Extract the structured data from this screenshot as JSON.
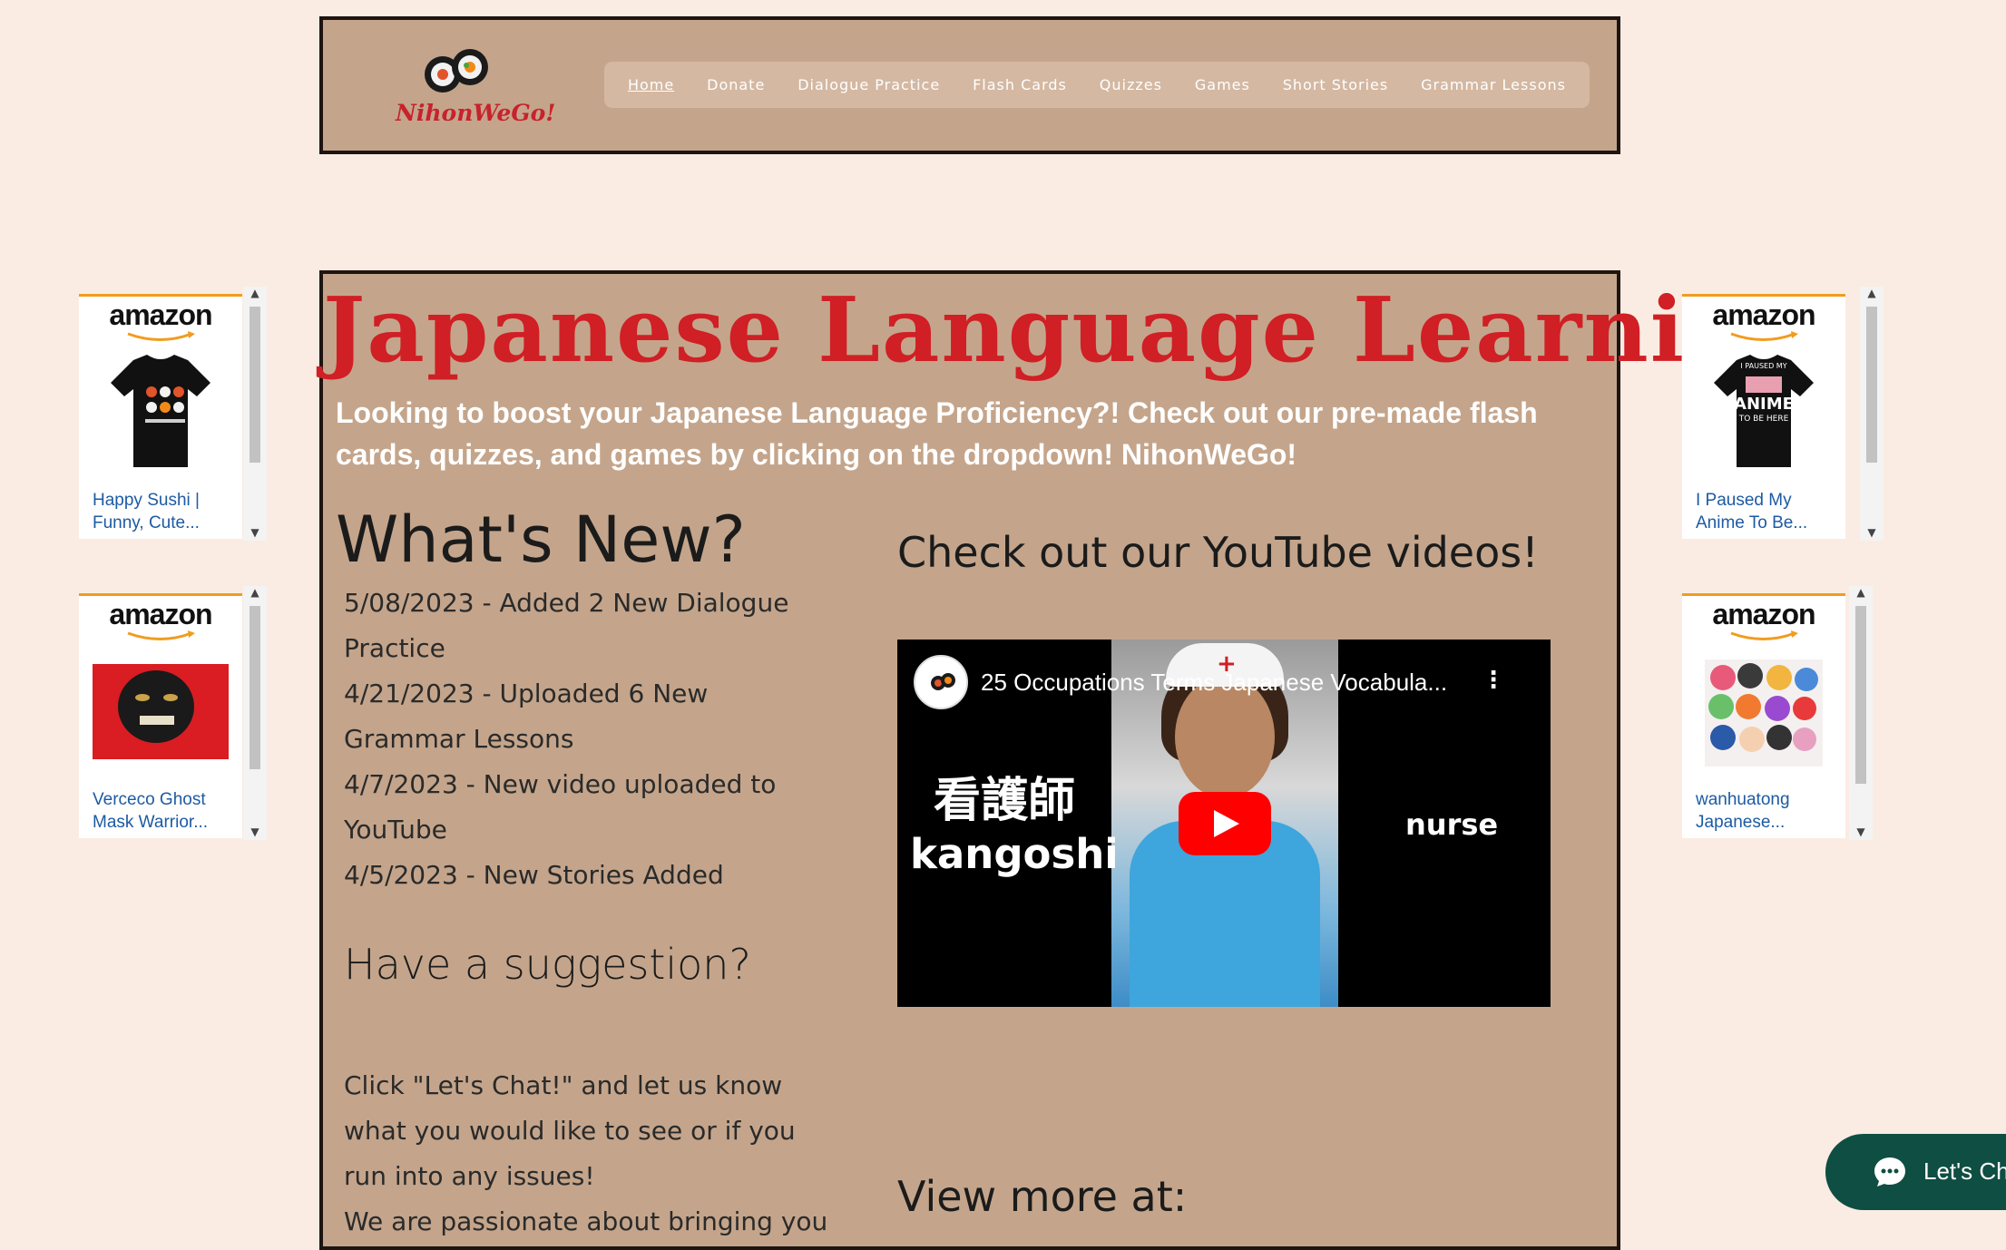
{
  "header": {
    "logo_text": "NihonWeGo!",
    "nav": [
      {
        "label": "Home"
      },
      {
        "label": "Donate"
      },
      {
        "label": "Dialogue Practice"
      },
      {
        "label": "Flash Cards"
      },
      {
        "label": "Quizzes"
      },
      {
        "label": "Games"
      },
      {
        "label": "Short Stories"
      },
      {
        "label": "Grammar Lessons"
      }
    ],
    "active_nav": "Home"
  },
  "main": {
    "hero_title": "Japanese Language Learning",
    "intro": "Looking to boost your Japanese Language Proficiency?! Check out our pre-made flash cards, quizzes, and games by clicking on the dropdown! NihonWeGo!",
    "whats_new_title": "What's New?",
    "news": [
      "5/08/2023 - Added 2 New Dialogue Practice",
      "4/21/2023 - Uploaded 6 New Grammar Lessons",
      "4/7/2023 - New video uploaded to YouTube",
      "4/5/2023 - New Stories Added"
    ],
    "suggestion_title": "Have a suggestion?",
    "suggestion_body_1": "Click \"Let's Chat!\" and let us know what you would like to see or if you run into any issues!",
    "suggestion_body_2": "We are passionate about bringing you",
    "youtube_heading": "Check out our YouTube videos!",
    "video": {
      "title": "25 Occupations Terms Japanese Vocabula...",
      "kanji": "看護師",
      "romaji": "kangoshi",
      "english": "nurse",
      "menu_glyph": "⋮"
    },
    "view_more": "View more at:"
  },
  "ads": {
    "logo": "amazon",
    "left_top": {
      "text": "Happy Sushi | Funny, Cute..."
    },
    "left_bottom": {
      "text": "Verceco Ghost Mask Warrior..."
    },
    "right_top": {
      "text": "I Paused My Anime To Be...",
      "shirt_text_1": "I PAUSED MY",
      "shirt_text_2": "ANIME",
      "shirt_text_3": "TO BE HERE"
    },
    "right_bottom": {
      "text": "wanhuatong Japanese..."
    }
  },
  "chat": {
    "label": "Let's Chat!"
  },
  "colors": {
    "page_bg": "#faece2",
    "panel_bg": "#c4a58b",
    "title_red": "#d01f25",
    "chat_green": "#0f4e42",
    "amazon_orange": "#f19c1f",
    "link_blue": "#1d5aa3"
  }
}
